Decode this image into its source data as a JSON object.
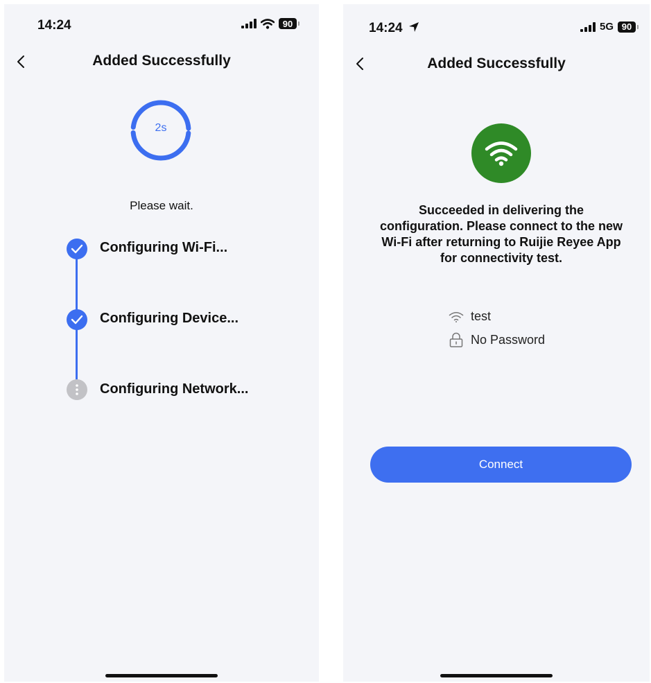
{
  "left_screen": {
    "status_bar": {
      "time": "14:24",
      "battery": "90",
      "icons": [
        "signal-icon",
        "wifi-icon",
        "battery-icon"
      ]
    },
    "nav": {
      "title": "Added Successfully",
      "back_icon": "chevron-left-icon"
    },
    "countdown": {
      "text": "2s",
      "color": "#3c6ef0"
    },
    "wait_text": "Please wait.",
    "steps": [
      {
        "label": "Configuring Wi-Fi...",
        "status": "done"
      },
      {
        "label": "Configuring Device...",
        "status": "done"
      },
      {
        "label": "Configuring Network...",
        "status": "pending"
      }
    ]
  },
  "right_screen": {
    "status_bar": {
      "time": "14:24",
      "network": "5G",
      "battery": "90",
      "icons": [
        "location-arrow-icon",
        "signal-icon",
        "battery-icon"
      ]
    },
    "nav": {
      "title": "Added Successfully",
      "back_icon": "chevron-left-icon"
    },
    "success_icon": {
      "name": "wifi-icon",
      "background": "#2f8a27"
    },
    "message": "Succeeded in delivering the configuration. Please connect to the new Wi-Fi after returning to Ruijie Reyee App for connectivity test.",
    "ssid": "test",
    "password_text": "No Password",
    "connect_button": "Connect"
  },
  "colors": {
    "accent": "#3c6ef0",
    "background": "#f4f5f9",
    "success": "#2f8a27",
    "pending": "#c2c2c6"
  }
}
